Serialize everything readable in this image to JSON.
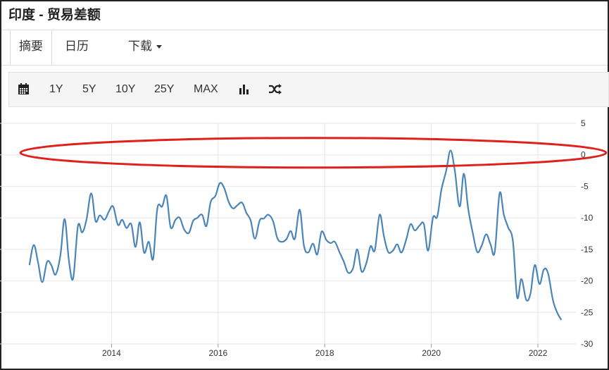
{
  "header": {
    "title": "印度 - 贸易差额"
  },
  "tabs": [
    {
      "label": "摘要"
    },
    {
      "label": "日历"
    },
    {
      "label": "下载"
    }
  ],
  "toolbar": {
    "ranges": [
      "1Y",
      "5Y",
      "10Y",
      "25Y",
      "MAX"
    ],
    "icons": [
      "calendar-icon",
      "bar-chart-icon",
      "shuffle-icon"
    ]
  },
  "colors": {
    "line": "#4a85b8",
    "annotation": "#e0211b",
    "grid": "#e6e6e6"
  },
  "chart_data": {
    "type": "line",
    "title": "",
    "xlabel": "",
    "ylabel": "",
    "xlim": [
      2012.5,
      2022.6
    ],
    "ylim": [
      -30,
      5
    ],
    "x_ticks": [
      "2014",
      "2016",
      "2018",
      "2020",
      "2022"
    ],
    "y_ticks": [
      "5",
      "0",
      "-5",
      "-10",
      "-15",
      "-20",
      "-25",
      "-30"
    ],
    "grid": true,
    "legend": "none",
    "annotation": "red ellipse around the 0 level",
    "series": [
      {
        "points": [
          [
            2012.46,
            -17.5
          ],
          [
            2012.54,
            -14.3
          ],
          [
            2012.62,
            -17.0
          ],
          [
            2012.7,
            -20.2
          ],
          [
            2012.79,
            -17.0
          ],
          [
            2012.87,
            -17.5
          ],
          [
            2012.95,
            -19.0
          ],
          [
            2013.04,
            -16.0
          ],
          [
            2013.12,
            -10.2
          ],
          [
            2013.2,
            -16.7
          ],
          [
            2013.28,
            -19.6
          ],
          [
            2013.37,
            -11.3
          ],
          [
            2013.45,
            -12.3
          ],
          [
            2013.53,
            -10.3
          ],
          [
            2013.62,
            -6.1
          ],
          [
            2013.7,
            -10.5
          ],
          [
            2013.78,
            -9.6
          ],
          [
            2013.87,
            -10.3
          ],
          [
            2013.95,
            -9.0
          ],
          [
            2014.03,
            -8.2
          ],
          [
            2014.12,
            -11.1
          ],
          [
            2014.2,
            -10.3
          ],
          [
            2014.28,
            -11.6
          ],
          [
            2014.37,
            -11.0
          ],
          [
            2014.45,
            -14.6
          ],
          [
            2014.53,
            -10.7
          ],
          [
            2014.61,
            -15.5
          ],
          [
            2014.7,
            -13.8
          ],
          [
            2014.78,
            -16.5
          ],
          [
            2014.86,
            -8.5
          ],
          [
            2014.95,
            -8.2
          ],
          [
            2015.03,
            -6.5
          ],
          [
            2015.11,
            -11.5
          ],
          [
            2015.2,
            -10.3
          ],
          [
            2015.28,
            -10.0
          ],
          [
            2015.36,
            -11.8
          ],
          [
            2015.45,
            -12.4
          ],
          [
            2015.53,
            -10.5
          ],
          [
            2015.61,
            -10.0
          ],
          [
            2015.7,
            -9.5
          ],
          [
            2015.78,
            -11.3
          ],
          [
            2015.86,
            -7.5
          ],
          [
            2015.95,
            -6.5
          ],
          [
            2016.03,
            -4.5
          ],
          [
            2016.11,
            -5.2
          ],
          [
            2016.2,
            -7.5
          ],
          [
            2016.28,
            -8.5
          ],
          [
            2016.36,
            -8.0
          ],
          [
            2016.45,
            -7.6
          ],
          [
            2016.53,
            -9.2
          ],
          [
            2016.61,
            -10.4
          ],
          [
            2016.69,
            -13.3
          ],
          [
            2016.78,
            -10.4
          ],
          [
            2016.86,
            -10.1
          ],
          [
            2016.94,
            -9.5
          ],
          [
            2017.03,
            -10.5
          ],
          [
            2017.11,
            -13.2
          ],
          [
            2017.19,
            -13.8
          ],
          [
            2017.28,
            -13.4
          ],
          [
            2017.36,
            -12.1
          ],
          [
            2017.44,
            -13.3
          ],
          [
            2017.53,
            -8.7
          ],
          [
            2017.61,
            -14.4
          ],
          [
            2017.69,
            -15.5
          ],
          [
            2017.78,
            -14.1
          ],
          [
            2017.86,
            -15.8
          ],
          [
            2017.94,
            -12.2
          ],
          [
            2018.03,
            -13.5
          ],
          [
            2018.11,
            -14.0
          ],
          [
            2018.19,
            -13.8
          ],
          [
            2018.28,
            -15.5
          ],
          [
            2018.36,
            -17.0
          ],
          [
            2018.44,
            -18.7
          ],
          [
            2018.53,
            -18.0
          ],
          [
            2018.61,
            -15.0
          ],
          [
            2018.69,
            -18.5
          ],
          [
            2018.78,
            -17.2
          ],
          [
            2018.86,
            -14.5
          ],
          [
            2018.94,
            -15.1
          ],
          [
            2019.03,
            -9.5
          ],
          [
            2019.11,
            -12.9
          ],
          [
            2019.19,
            -15.4
          ],
          [
            2019.28,
            -15.2
          ],
          [
            2019.36,
            -14.2
          ],
          [
            2019.44,
            -15.5
          ],
          [
            2019.53,
            -13.4
          ],
          [
            2019.61,
            -11.0
          ],
          [
            2019.69,
            -12.0
          ],
          [
            2019.78,
            -11.2
          ],
          [
            2019.86,
            -11.0
          ],
          [
            2019.94,
            -15.2
          ],
          [
            2020.03,
            -10.0
          ],
          [
            2020.11,
            -9.8
          ],
          [
            2020.19,
            -5.5
          ],
          [
            2020.28,
            -2.5
          ],
          [
            2020.36,
            0.7
          ],
          [
            2020.44,
            -2.5
          ],
          [
            2020.53,
            -8.2
          ],
          [
            2020.61,
            -3.0
          ],
          [
            2020.69,
            -8.5
          ],
          [
            2020.78,
            -12.5
          ],
          [
            2020.86,
            -15.4
          ],
          [
            2020.94,
            -14.5
          ],
          [
            2021.03,
            -12.6
          ],
          [
            2021.11,
            -14.2
          ],
          [
            2021.19,
            -15.4
          ],
          [
            2021.28,
            -6.1
          ],
          [
            2021.36,
            -9.5
          ],
          [
            2021.44,
            -11.5
          ],
          [
            2021.53,
            -13.7
          ],
          [
            2021.61,
            -22.6
          ],
          [
            2021.69,
            -19.7
          ],
          [
            2021.78,
            -23.0
          ],
          [
            2021.86,
            -22.0
          ],
          [
            2021.94,
            -17.5
          ],
          [
            2022.03,
            -20.5
          ],
          [
            2022.11,
            -18.2
          ],
          [
            2022.19,
            -18.8
          ],
          [
            2022.28,
            -23.0
          ],
          [
            2022.36,
            -25.0
          ],
          [
            2022.44,
            -26.2
          ]
        ]
      }
    ]
  }
}
